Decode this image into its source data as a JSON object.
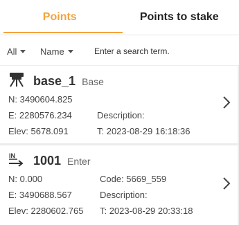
{
  "tabs": [
    {
      "label": "Points",
      "active": true
    },
    {
      "label": "Points to stake",
      "active": false
    }
  ],
  "filter": {
    "type_selected": "All",
    "field_selected": "Name",
    "search_placeholder": "Enter a search term."
  },
  "points": [
    {
      "icon": "base-station-icon",
      "name": "base_1",
      "type": "Base",
      "n_label": "N: 3490604.825",
      "e_label": "E: 2280576.234",
      "elev_label": "Elev: 5678.091",
      "code_label": "",
      "description_label": "Description:",
      "time_label": "T: 2023-08-29 16:18:36"
    },
    {
      "icon": "input-arrow-icon",
      "name": "1001",
      "type": "Enter",
      "n_label": "N: 0.000",
      "e_label": "E: 3490688.567",
      "elev_label": "Elev: 2280602.765",
      "code_label": "Code: 5669_559",
      "description_label": "Description:",
      "time_label": "T: 2023-08-29 20:33:18"
    }
  ],
  "colors": {
    "accent": "#f4a33c",
    "text": "#333333",
    "divider": "#ececec"
  }
}
